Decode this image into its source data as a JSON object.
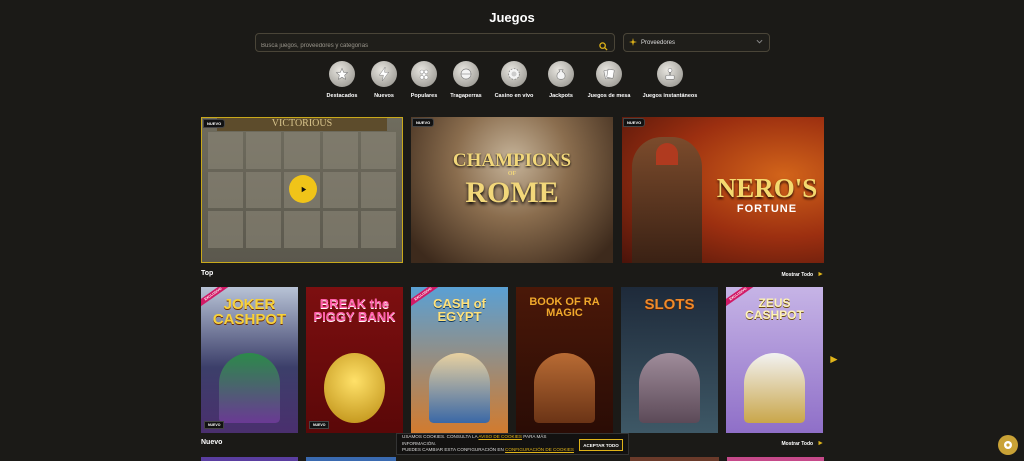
{
  "header": {
    "title": "Juegos"
  },
  "search": {
    "placeholder": "Busca juegos, proveedores y categorías",
    "icon": "search-icon"
  },
  "providers": {
    "label": "Proveedores",
    "icon": "filter-icon"
  },
  "categories": [
    {
      "label": "Destacados",
      "icon": "star-icon"
    },
    {
      "label": "Nuevos",
      "icon": "bolt-icon"
    },
    {
      "label": "Populares",
      "icon": "grapes-icon"
    },
    {
      "label": "Tragaperras",
      "icon": "slot-ball-icon"
    },
    {
      "label": "Casino en vivo",
      "icon": "chip-icon"
    },
    {
      "label": "Jackpots",
      "icon": "money-bag-icon"
    },
    {
      "label": "Juegos de mesa",
      "icon": "cards-icon"
    },
    {
      "label": "Juegos instantáneos",
      "icon": "joystick-icon"
    }
  ],
  "featured": [
    {
      "badge": "NUEVO",
      "title": "VICTORIOUS"
    },
    {
      "badge": "NUEVO",
      "title_line1": "CHAMPIONS",
      "title_line2": "OF",
      "title_line3": "ROME"
    },
    {
      "badge": "NUEVO",
      "title_line1": "NERO'S",
      "title_line2": "FORTUNE"
    }
  ],
  "sections": {
    "top": {
      "title": "Top",
      "show_all": "Mostrar Todo"
    },
    "new": {
      "title": "Nuevo",
      "show_all": "Mostrar Todo"
    }
  },
  "top_games": [
    {
      "name": "JOKER CASHPOT",
      "exclusive": "EXCLUSIVO",
      "badge": "NUEVO"
    },
    {
      "name": "BREAK the PIGGY BANK",
      "badge": "NUEVO"
    },
    {
      "name": "CASH of EGYPT",
      "exclusive": "EXCLUSIVO"
    },
    {
      "name": "BOOK OF RA MAGIC"
    },
    {
      "name": "SLOTS"
    },
    {
      "name": "ZEUS CASHPOT",
      "exclusive": "EXCLUSIVO"
    }
  ],
  "cookie": {
    "text_a": "USAMOS COOKIES. CONSULTA LA ",
    "link_a": "AVISO DE COOKIES",
    "text_b": " PARA MÁS INFORMACIÓN.",
    "text_c": "PUEDES CAMBIAR ESTA CONFIGURACIÓN EN ",
    "link_b": "CONFIGURACIÓN DE COOKIES",
    "accept": "ACEPTAR TODO"
  },
  "colors": {
    "background": "#1b1a17",
    "accent": "#e0b419",
    "exclusive": "#d11a66"
  }
}
